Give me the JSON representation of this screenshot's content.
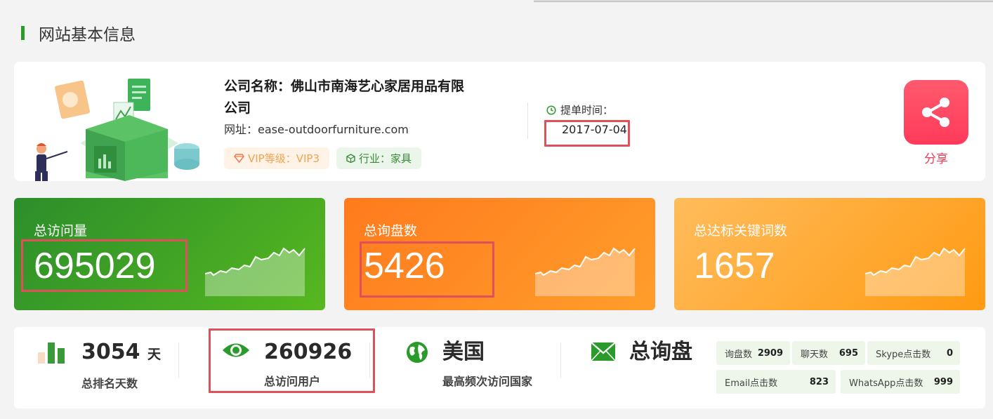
{
  "section": {
    "title": "网站基本信息"
  },
  "company": {
    "name_label": "公司名称：",
    "name_line1": "佛山市南海艺心家居用品有限",
    "name_line2": "公司",
    "url_label": "网址：",
    "url": "ease-outdoorfurniture.com",
    "vip_label": "VIP等级：VIP3",
    "industry_label": "行业：家具"
  },
  "submit": {
    "label": "提单时间：",
    "date": "2017-07-04"
  },
  "share": {
    "label": "分享"
  },
  "stats": [
    {
      "title": "总访问量",
      "value": "695029"
    },
    {
      "title": "总询盘数",
      "value": "5426"
    },
    {
      "title": "总达标关键词数",
      "value": "1657"
    }
  ],
  "bottom": {
    "rank": {
      "value": "3054",
      "unit": "天",
      "label": "总排名天数"
    },
    "visitors": {
      "value": "260926",
      "label": "总访问用户"
    },
    "country": {
      "value": "美国",
      "label": "最高频次访问国家"
    },
    "inquiry": {
      "value": "总询盘"
    },
    "chips": [
      {
        "label": "询盘数",
        "value": "2909"
      },
      {
        "label": "聊天数",
        "value": "695"
      },
      {
        "label": "Skype点击数",
        "value": "0"
      },
      {
        "label": "Email点击数",
        "value": "823"
      },
      {
        "label": "WhatsApp点击数",
        "value": "999"
      }
    ]
  },
  "colors": {
    "accent_green": "#2a9a2a",
    "highlight_red": "#e0505a",
    "share_red": "#ff3a5a"
  }
}
